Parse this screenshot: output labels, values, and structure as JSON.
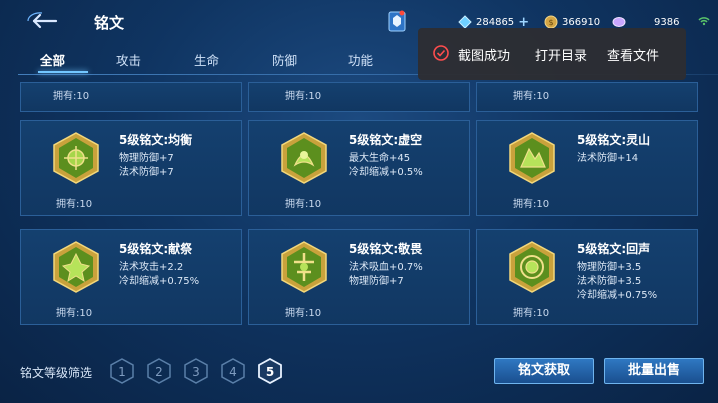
{
  "header": {
    "title": "铭文",
    "resources": [
      {
        "icon": "diamond-gem-icon",
        "value": "284865",
        "color": "#6fd0ff"
      },
      {
        "icon": "gold-coin-icon",
        "value": "366910",
        "color": "#d4a645"
      },
      {
        "icon": "crystal-icon",
        "value": "9386",
        "color": "#c9a6ff"
      }
    ]
  },
  "tabs": [
    {
      "label": "全部",
      "active": true
    },
    {
      "label": "攻击",
      "active": false
    },
    {
      "label": "生命",
      "active": false
    },
    {
      "label": "防御",
      "active": false
    },
    {
      "label": "功能",
      "active": false
    }
  ],
  "partial_row": {
    "owned": [
      "拥有:10",
      "拥有:10",
      "拥有:10"
    ]
  },
  "cards": [
    {
      "name": "5级铭文:均衡",
      "stats": [
        "物理防御+7",
        "法术防御+7"
      ],
      "owned": "拥有:10",
      "icon": "balance-emblem-icon"
    },
    {
      "name": "5级铭文:虚空",
      "stats": [
        "最大生命+45",
        "冷却缩减+0.5%"
      ],
      "owned": "拥有:10",
      "icon": "void-emblem-icon"
    },
    {
      "name": "5级铭文:灵山",
      "stats": [
        "法术防御+14"
      ],
      "owned": "拥有:10",
      "icon": "spirit-mountain-emblem-icon"
    },
    {
      "name": "5级铭文:献祭",
      "stats": [
        "法术攻击+2.2",
        "冷却缩减+0.75%"
      ],
      "owned": "拥有:10",
      "icon": "sacrifice-emblem-icon"
    },
    {
      "name": "5级铭文:敬畏",
      "stats": [
        "法术吸血+0.7%",
        "物理防御+7"
      ],
      "owned": "拥有:10",
      "icon": "awe-emblem-icon"
    },
    {
      "name": "5级铭文:回声",
      "stats": [
        "物理防御+3.5",
        "法术防御+3.5",
        "冷却缩减+0.75%"
      ],
      "owned": "拥有:10",
      "icon": "echo-emblem-icon"
    }
  ],
  "filter": {
    "label": "铭文等级筛选",
    "levels": [
      "1",
      "2",
      "3",
      "4",
      "5"
    ],
    "selected": "5"
  },
  "buttons": {
    "acquire": "铭文获取",
    "bulk_sell": "批量出售"
  },
  "toast": {
    "message": "截图成功",
    "open_folder": "打开目录",
    "view_file": "查看文件"
  }
}
